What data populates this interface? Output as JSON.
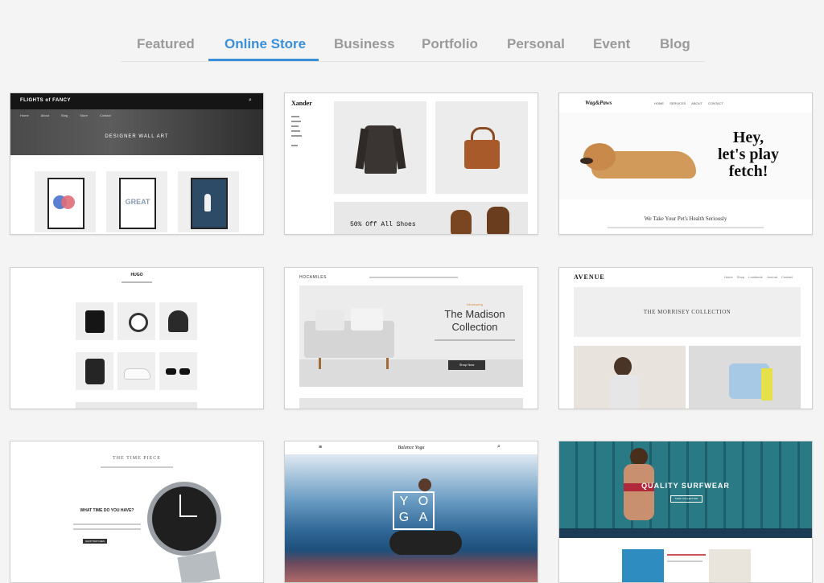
{
  "tabs": [
    {
      "label": "Featured"
    },
    {
      "label": "Online Store",
      "active": true
    },
    {
      "label": "Business"
    },
    {
      "label": "Portfolio"
    },
    {
      "label": "Personal"
    },
    {
      "label": "Event"
    },
    {
      "label": "Blog"
    }
  ],
  "colors": {
    "accent": "#3a8fd9",
    "tab_inactive": "#9a9a9a",
    "background": "#f4f4f4"
  },
  "templates": {
    "flights": {
      "logo": "FLIGHTS of FANCY",
      "nav": [
        "Home",
        "About",
        "Blog",
        "Store",
        "Contact"
      ],
      "hero": "DESIGNER WALL ART",
      "print_text": "GREAT"
    },
    "xander": {
      "logo": "Xander",
      "promo": "50% Off All Shoes"
    },
    "wag": {
      "logo": "Wag&Paws",
      "nav": [
        "HOME",
        "SERVICES",
        "ABOUT",
        "CONTACT"
      ],
      "headline": [
        "Hey,",
        "let's play",
        "fetch!"
      ],
      "sub": "We Take Your Pet's Health Seriously"
    },
    "hugo": {
      "logo": "HUGO"
    },
    "madison": {
      "logo": "HOCAMILES",
      "kicker": "Introducing",
      "title": [
        "The Madison",
        "Collection"
      ],
      "button": "Shop Now"
    },
    "avenue": {
      "logo": "AVENUE",
      "nav": [
        "Home",
        "Shop",
        "Lookbook",
        "Journal",
        "Contact"
      ],
      "banner": "THE MORRISEY COLLECTION"
    },
    "timepiece": {
      "logo": "THE TIME PIECE",
      "question": "WHAT TIME DO YOU HAVE?",
      "button": "SHOP WATCHES"
    },
    "yoga": {
      "logo": "Balance Yoga",
      "letters": [
        "Y",
        "O",
        "G",
        "A"
      ]
    },
    "surf": {
      "title": "QUALITY SURFWEAR",
      "cta": "SHOP COLLECTION"
    }
  }
}
